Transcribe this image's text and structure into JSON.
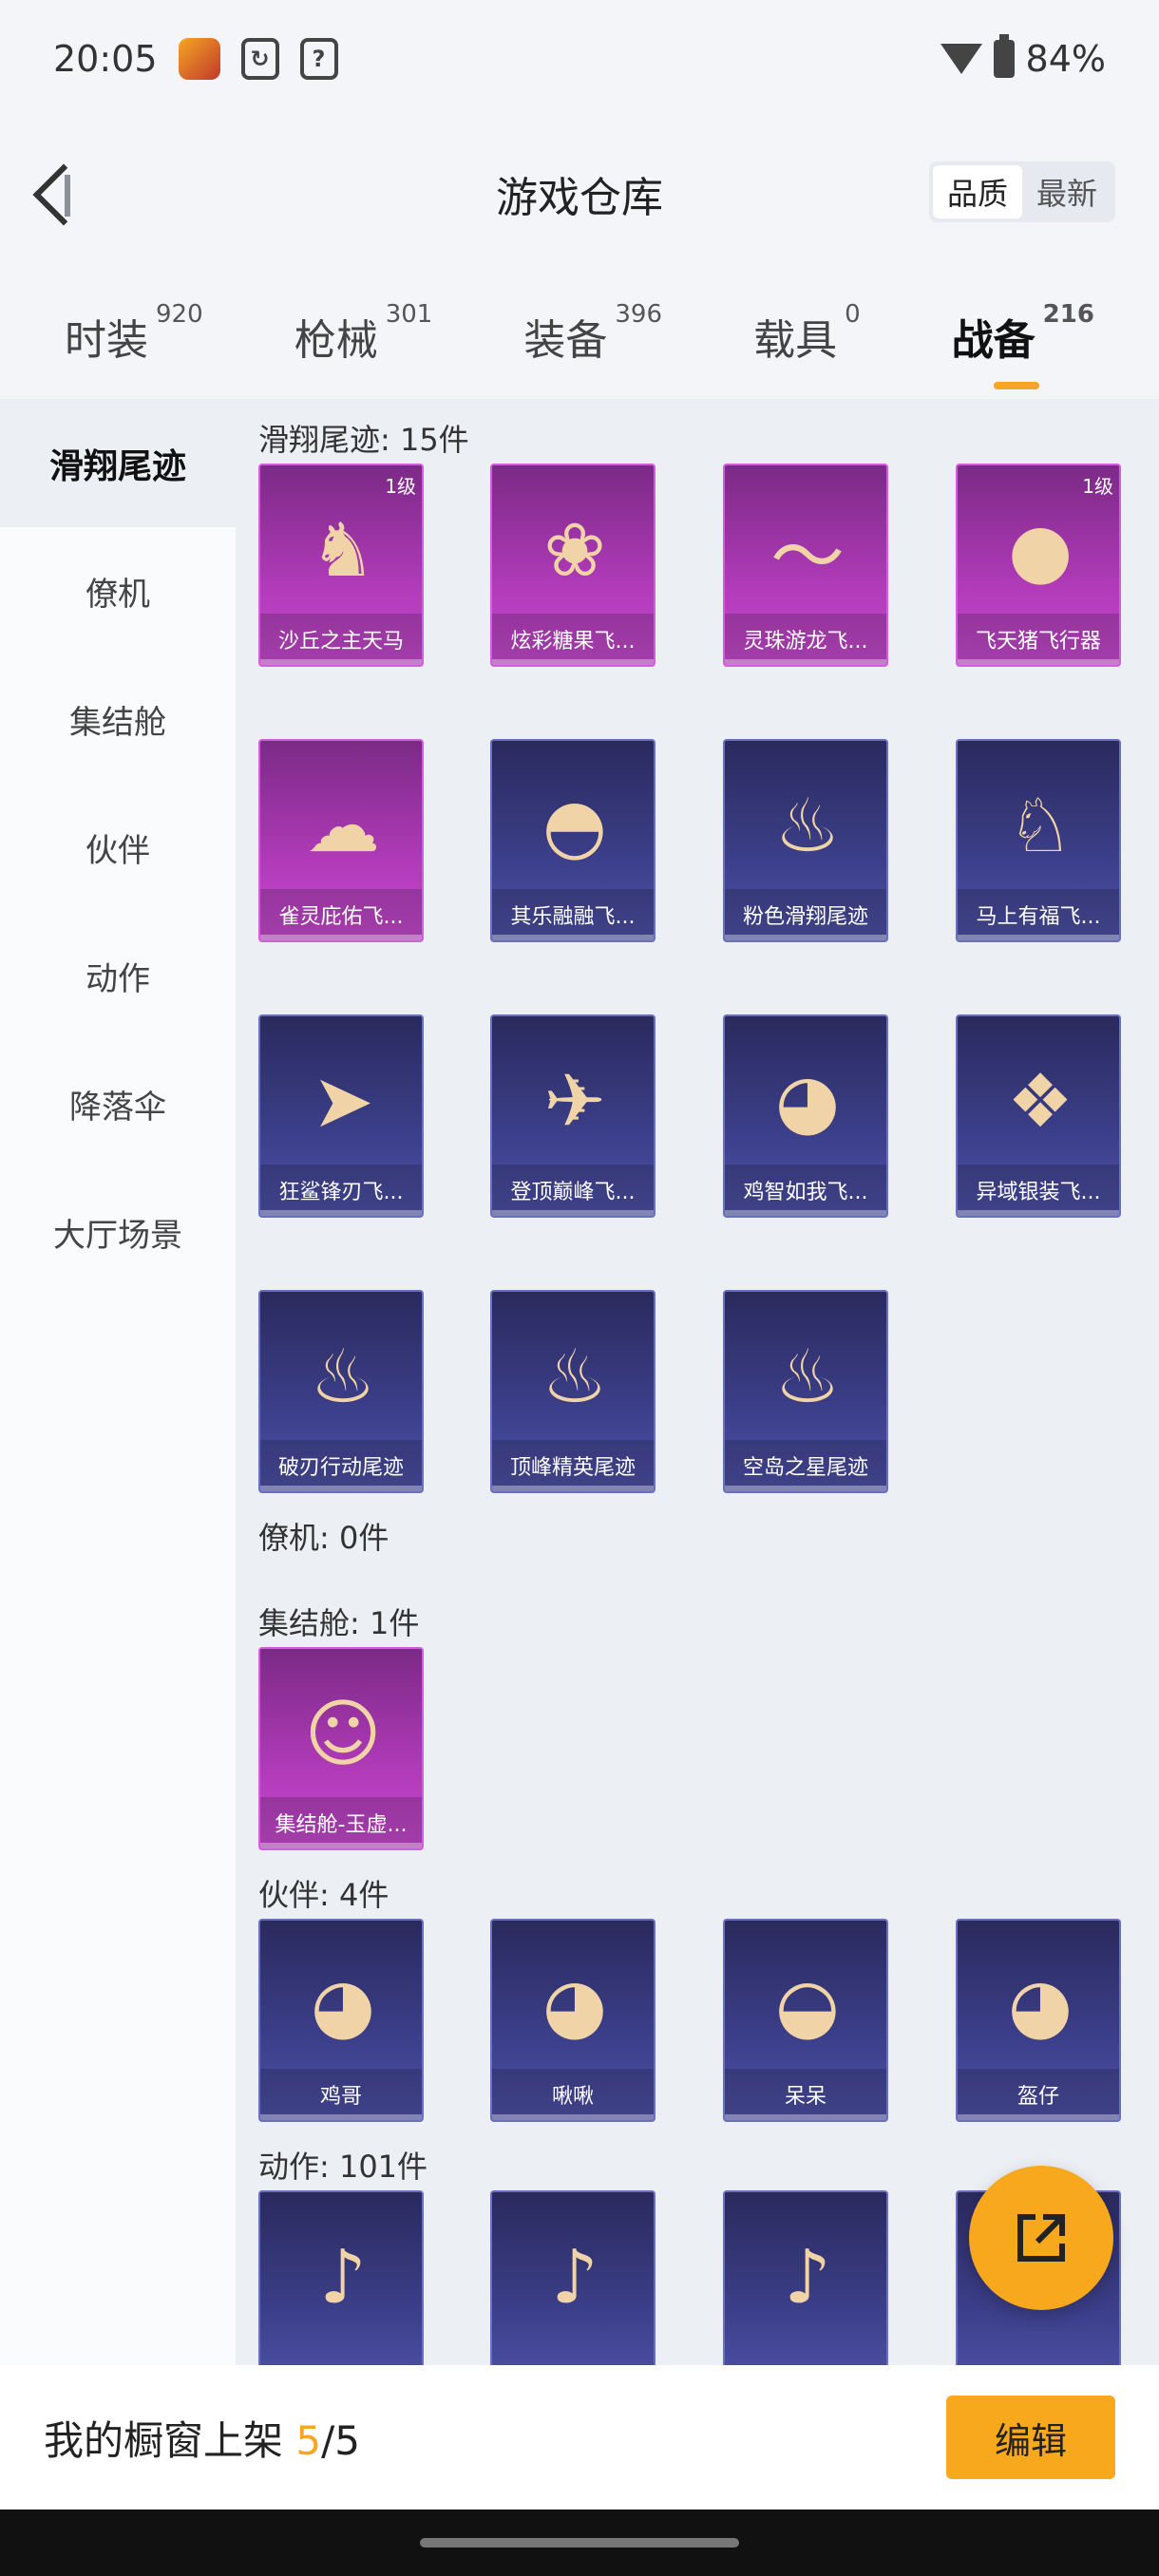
{
  "status_bar": {
    "time": "20:05",
    "battery": "84%"
  },
  "header": {
    "title": "游戏仓库",
    "sort_options": [
      "品质",
      "最新"
    ],
    "sort_active": 0
  },
  "tabs": [
    {
      "label": "时装",
      "count": "920"
    },
    {
      "label": "枪械",
      "count": "301"
    },
    {
      "label": "装备",
      "count": "396"
    },
    {
      "label": "载具",
      "count": "0"
    },
    {
      "label": "战备",
      "count": "216"
    }
  ],
  "active_tab": 4,
  "sidebar": {
    "items": [
      "滑翔尾迹",
      "僚机",
      "集结舱",
      "伙伴",
      "动作",
      "降落伞",
      "大厅场景"
    ],
    "active": 0
  },
  "sections": [
    {
      "title": "滑翔尾迹: 15件",
      "items": [
        {
          "name": "沙丘之主天马",
          "rarity": "purple",
          "level": "1级",
          "icon": "pegasus-chariot-icon"
        },
        {
          "name": "炫彩糖果飞...",
          "rarity": "purple",
          "icon": "candy-wings-icon"
        },
        {
          "name": "灵珠游龙飞...",
          "rarity": "purple",
          "icon": "dragon-icon"
        },
        {
          "name": "飞天猪飞行器",
          "rarity": "purple",
          "level": "1级",
          "icon": "flying-pig-icon"
        },
        {
          "name": "雀灵庇佑飞...",
          "rarity": "purple",
          "icon": "golden-bird-icon"
        },
        {
          "name": "其乐融融飞...",
          "rarity": "blue",
          "icon": "penguin-icon"
        },
        {
          "name": "粉色滑翔尾迹",
          "rarity": "blue",
          "icon": "pink-trail-icon"
        },
        {
          "name": "马上有福飞...",
          "rarity": "blue",
          "icon": "horse-toy-icon"
        },
        {
          "name": "狂鲨锋刃飞...",
          "rarity": "blue",
          "icon": "shark-icon"
        },
        {
          "name": "登顶巅峰飞...",
          "rarity": "blue",
          "icon": "jet-icon"
        },
        {
          "name": "鸡智如我飞...",
          "rarity": "blue",
          "icon": "chicken-icon"
        },
        {
          "name": "异域银装飞...",
          "rarity": "blue",
          "icon": "silver-wing-icon"
        },
        {
          "name": "破刃行动尾迹",
          "rarity": "blue",
          "icon": "rainbow-trail-icon"
        },
        {
          "name": "顶峰精英尾迹",
          "rarity": "blue",
          "icon": "blue-trail-icon"
        },
        {
          "name": "空岛之星尾迹",
          "rarity": "blue",
          "icon": "star-trail-icon"
        }
      ]
    },
    {
      "title": "僚机: 0件",
      "items": []
    },
    {
      "title": "集结舱: 1件",
      "items": [
        {
          "name": "集结舱-玉虚...",
          "rarity": "purple",
          "icon": "pod-icon"
        }
      ]
    },
    {
      "title": "伙伴: 4件",
      "items": [
        {
          "name": "鸡哥",
          "rarity": "blue",
          "icon": "chicken-icon"
        },
        {
          "name": "啾啾",
          "rarity": "blue",
          "icon": "pink-bird-icon"
        },
        {
          "name": "呆呆",
          "rarity": "blue",
          "icon": "chick-icon"
        },
        {
          "name": "盔仔",
          "rarity": "blue",
          "icon": "helmet-chick-icon"
        }
      ]
    },
    {
      "title": "动作: 101件",
      "items": [
        {
          "name": "",
          "rarity": "blue",
          "icon": "dance-icon"
        },
        {
          "name": "",
          "rarity": "blue",
          "icon": "dance-icon"
        },
        {
          "name": "",
          "rarity": "blue",
          "icon": "dance-icon"
        },
        {
          "name": "",
          "rarity": "blue",
          "icon": "dance-icon"
        }
      ]
    }
  ],
  "bottom_bar": {
    "label": "我的橱窗上架 ",
    "shown": "5",
    "sep": "/",
    "total": "5",
    "edit_label": "编辑"
  },
  "colors": {
    "accent": "#f8a81c",
    "purple": "#b03ab8",
    "blue": "#3c3f8a"
  }
}
